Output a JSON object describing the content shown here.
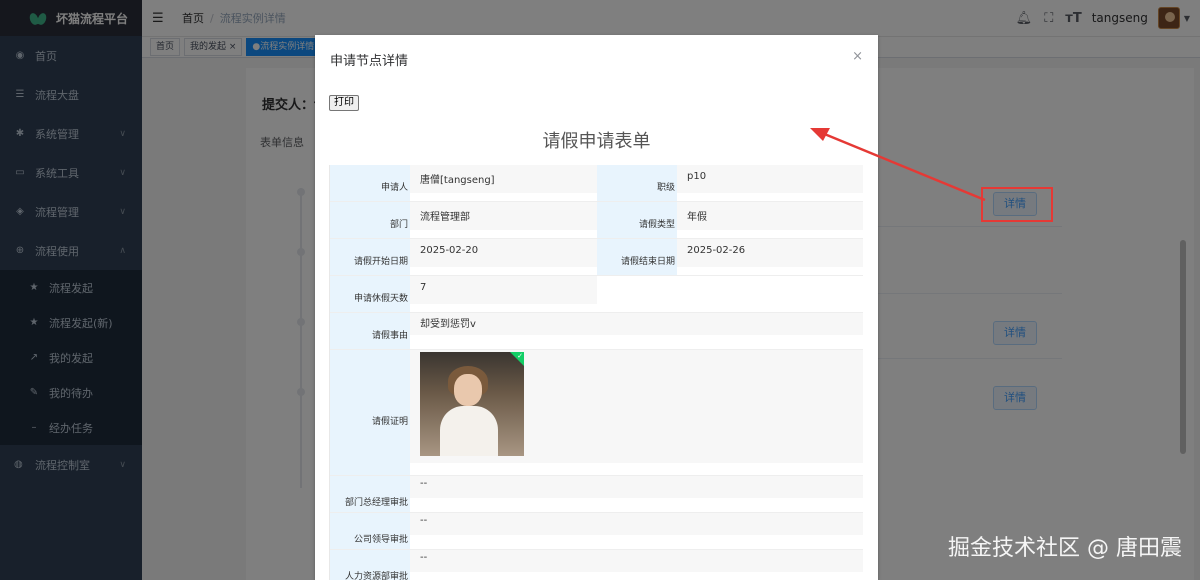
{
  "app": {
    "title": "坏猫流程平台"
  },
  "sidebar": {
    "items": [
      {
        "label": "首页",
        "icon": "dashboard-icon"
      },
      {
        "label": "流程大盘",
        "icon": "list-icon"
      },
      {
        "label": "系统管理",
        "icon": "gear-icon"
      },
      {
        "label": "系统工具",
        "icon": "toolbox-icon"
      },
      {
        "label": "流程管理",
        "icon": "flow-icon"
      },
      {
        "label": "流程使用",
        "icon": "plus-circle-icon"
      }
    ],
    "sub_items": [
      {
        "label": "流程发起"
      },
      {
        "label": "流程发起(新)"
      },
      {
        "label": "我的发起"
      },
      {
        "label": "我的待办"
      },
      {
        "label": "经办任务"
      }
    ],
    "after": {
      "label": "流程控制室"
    }
  },
  "header": {
    "breadcrumb": [
      "首页",
      "流程实例详情"
    ],
    "user": "tangseng"
  },
  "tags": [
    "首页",
    "我的发起 ×",
    "●流程实例详情 ×"
  ],
  "page": {
    "submitter_label": "提交人：ta",
    "form_info_label": "表单信息",
    "detail_button": "详情"
  },
  "dialog": {
    "title": "申请节点详情",
    "print_button": "打印",
    "form_heading": "请假申请表单",
    "fields": {
      "applicant_label": "申请人",
      "applicant_value": "唐僧[tangseng]",
      "level_label": "职级",
      "level_value": "p10",
      "dept_label": "部门",
      "dept_value": "流程管理部",
      "leave_type_label": "请假类型",
      "leave_type_value": "年假",
      "start_label": "请假开始日期",
      "start_value": "2025-02-20",
      "end_label": "请假结束日期",
      "end_value": "2025-02-26",
      "days_label": "申请休假天数",
      "days_value": "7",
      "reason_label": "请假事由",
      "reason_value": "却受到惩罚v",
      "proof_label": "请假证明",
      "dept_mgr_label": "部门总经理审批",
      "dept_mgr_value": "--",
      "leader_label": "公司领导审批",
      "leader_value": "--",
      "hr_label": "人力资源部审批",
      "hr_value": "--"
    }
  },
  "watermark": "掘金技术社区 @ 唐田震",
  "colors": {
    "sidebar": "#304156",
    "accent": "#409eff",
    "callout": "#e53935"
  }
}
